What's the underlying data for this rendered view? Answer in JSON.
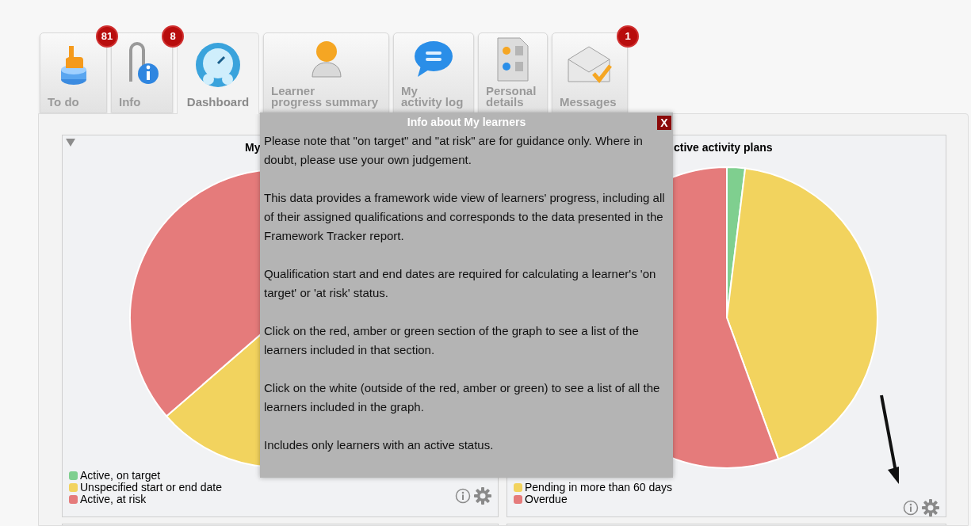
{
  "tabs": [
    {
      "kind": "todo",
      "label": [
        "To do"
      ],
      "badge": "81",
      "selected": false
    },
    {
      "kind": "info",
      "label": [
        "Info"
      ],
      "badge": "8",
      "selected": false
    },
    {
      "kind": "dashboard",
      "label": [
        "Dashboard"
      ],
      "selected": true
    },
    {
      "kind": "learner",
      "label": [
        "Learner",
        "progress summary"
      ],
      "selected": false
    },
    {
      "kind": "activity",
      "label": [
        "My",
        "activity log"
      ],
      "selected": false
    },
    {
      "kind": "personal",
      "label": [
        "Personal",
        "details"
      ],
      "selected": false
    },
    {
      "kind": "messages",
      "label": [
        "Messages"
      ],
      "badge": "1",
      "selected": false
    }
  ],
  "charts": [
    {
      "title": "My",
      "legend": [
        {
          "label": "Active, on target",
          "color": "#7fcf8f"
        },
        {
          "label": "Unspecified start or end date",
          "color": "#f2d35e"
        },
        {
          "label": "Active, at risk",
          "color": "#e57b7b"
        }
      ]
    },
    {
      "title": "ctive activity plans",
      "legend": [
        {
          "label": "Pending in more than 60 days",
          "color": "#f2d35e"
        },
        {
          "label": "Overdue",
          "color": "#e57b7b"
        }
      ]
    }
  ],
  "popup": {
    "title": "Info about My learners",
    "close": "X",
    "paragraphs": [
      "Please note that \"on target\" and \"at risk\" are for guidance only. Where in doubt, please use your own judgement.",
      "This data provides a framework wide view of learners' progress, including all of their assigned qualifications and corresponds to the data presented in the Framework Tracker report.",
      "Qualification start and end dates are required for calculating a learner's 'on target' or 'at risk' status.",
      "Click on the red, amber or green section of the graph to see a list of the learners included in that section.",
      "Click on the white (outside of the red, amber or green) to see a list of all the learners included in the graph.",
      "Includes only learners with an active status."
    ]
  }
}
